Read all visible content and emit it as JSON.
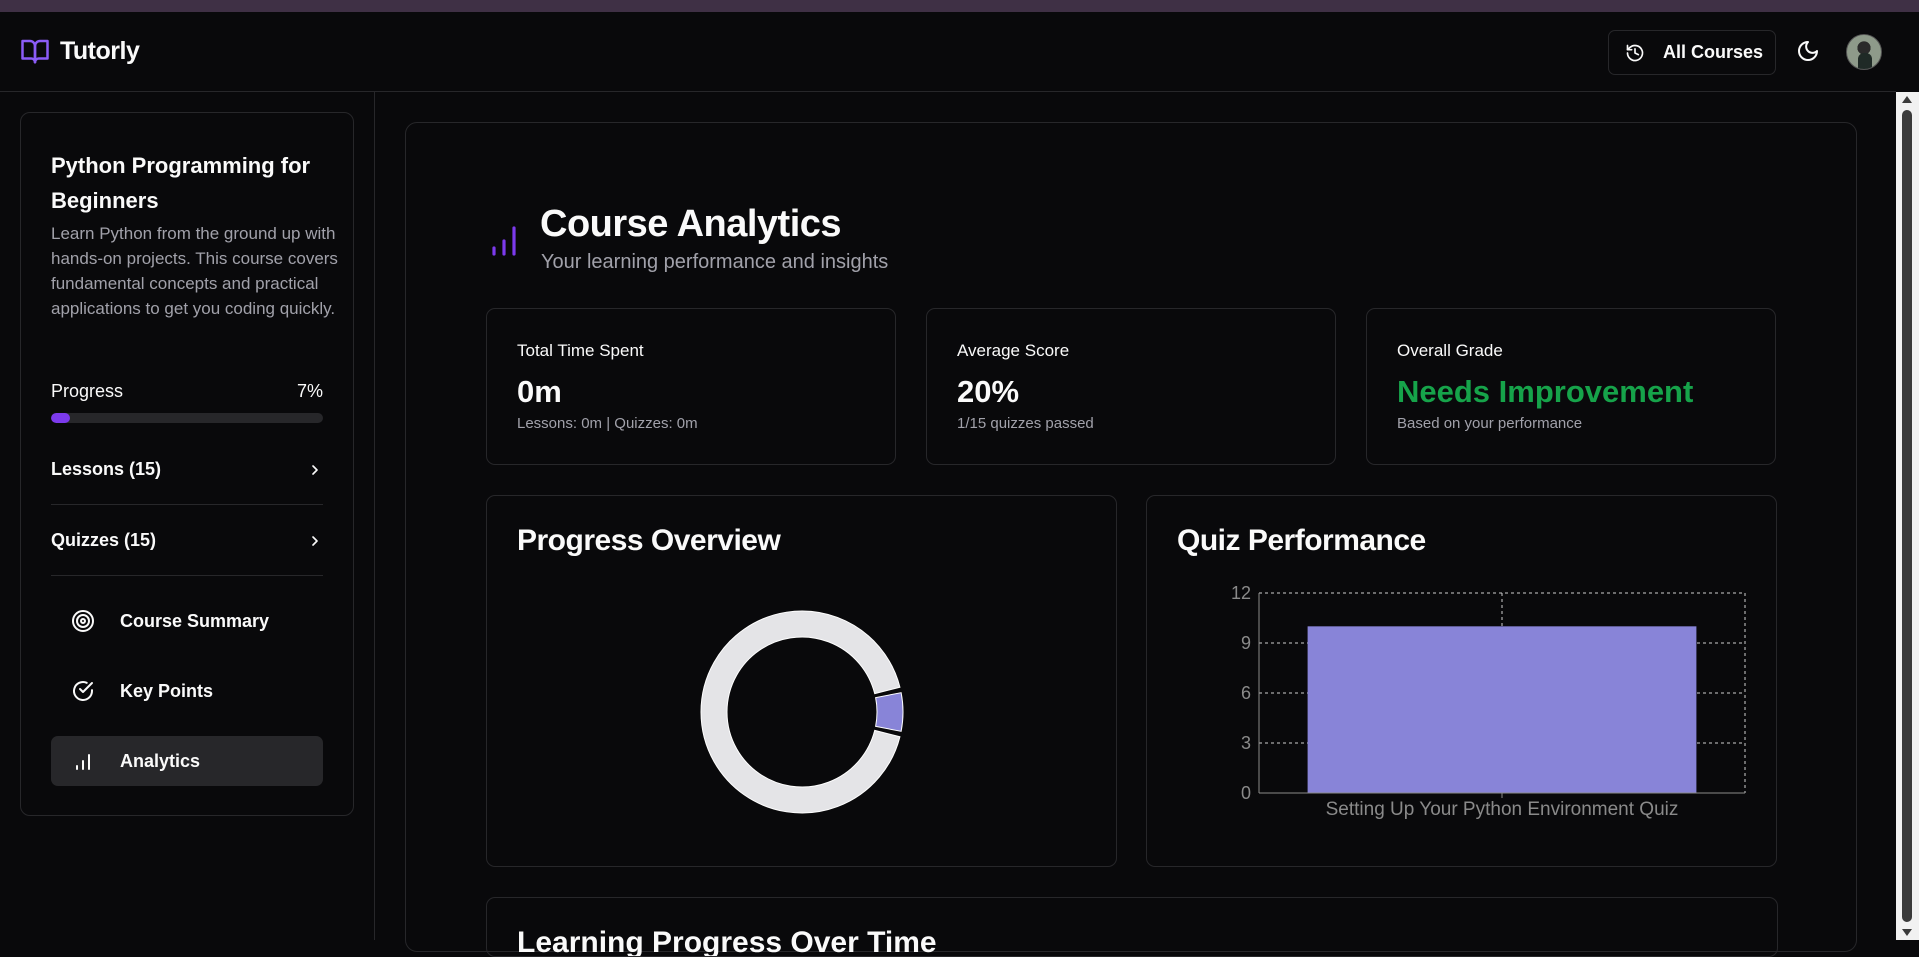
{
  "app": {
    "name": "Tutorly"
  },
  "header": {
    "all_courses_label": "All Courses"
  },
  "sidebar": {
    "course_title": "Python Programming for Beginners",
    "course_description": "Learn Python from the ground up with hands-on projects. This course covers fundamental concepts and practical applications to get you coding quickly.",
    "progress_label": "Progress",
    "progress_value": "7%",
    "progress_fraction": 0.07,
    "sections": [
      {
        "label": "Lessons (15)"
      },
      {
        "label": "Quizzes (15)"
      }
    ],
    "nav": [
      {
        "label": "Course Summary",
        "icon": "target-icon"
      },
      {
        "label": "Key Points",
        "icon": "check-circle-icon"
      },
      {
        "label": "Analytics",
        "icon": "bar-chart-icon",
        "active": true
      }
    ]
  },
  "main": {
    "title": "Course Analytics",
    "subtitle": "Your learning performance and insights",
    "stats": [
      {
        "label": "Total Time Spent",
        "value": "0m",
        "note": "Lessons: 0m | Quizzes: 0m"
      },
      {
        "label": "Average Score",
        "value": "20%",
        "note": "1/15 quizzes passed"
      },
      {
        "label": "Overall Grade",
        "value": "Needs Improvement",
        "note": "Based on your performance",
        "color": "#16a34a"
      }
    ],
    "panels": {
      "progress_title": "Progress Overview",
      "quiz_title": "Quiz Performance"
    },
    "bottom_title": "Learning Progress Over Time"
  },
  "chart_data": [
    {
      "type": "pie",
      "donut": true,
      "slices": [
        {
          "value": 7,
          "color": "#8884d8"
        },
        {
          "value": 93,
          "color": "#e4e4e7"
        }
      ]
    },
    {
      "type": "bar",
      "categories": [
        "Setting Up Your Python Environment Quiz"
      ],
      "values": [
        10
      ],
      "ylim": [
        0,
        12
      ],
      "yticks": [
        "0",
        "3",
        "6",
        "9",
        "12"
      ],
      "grid": true,
      "color": "#8884d8"
    }
  ],
  "colors": {
    "accent": "#7c3aed",
    "success": "#16a34a",
    "bar": "#8884d8"
  }
}
